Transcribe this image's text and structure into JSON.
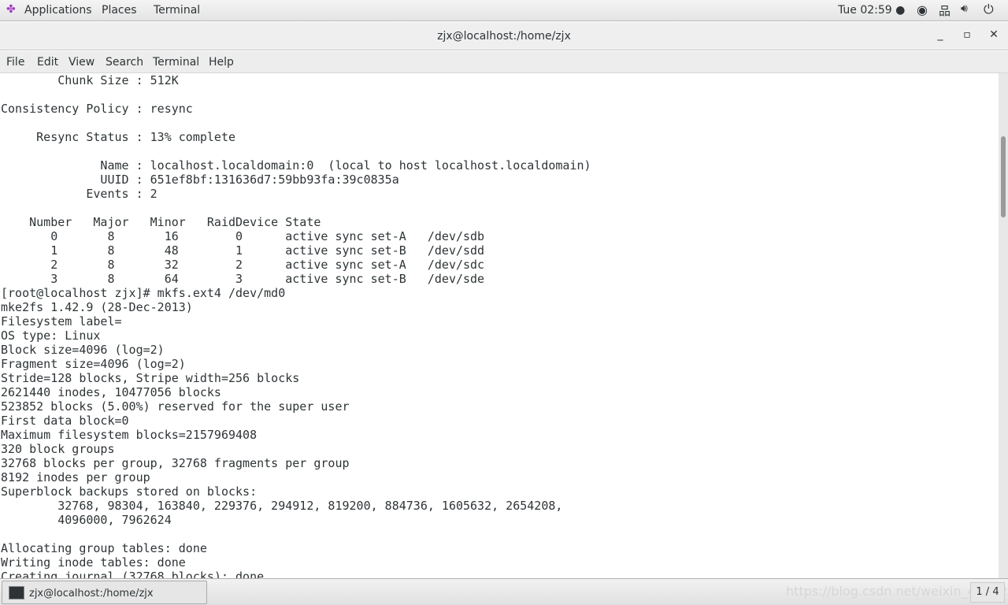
{
  "topbar": {
    "applications": "Applications",
    "places": "Places",
    "terminal": "Terminal",
    "clock": "Tue 02:59 ●",
    "icons": [
      "accessibility-icon",
      "network-icon",
      "volume-icon",
      "power-icon"
    ]
  },
  "window": {
    "title": "zjx@localhost:/home/zjx",
    "minimize": "_",
    "maximize": "▫",
    "close": "✕"
  },
  "menu": [
    "File",
    "Edit",
    "View",
    "Search",
    "Terminal",
    "Help"
  ],
  "terminal": {
    "output": "        Chunk Size : 512K\n\nConsistency Policy : resync\n\n     Resync Status : 13% complete\n\n              Name : localhost.localdomain:0  (local to host localhost.localdomain)\n              UUID : 651ef8bf:131636d7:59bb93fa:39c0835a\n            Events : 2\n\n    Number   Major   Minor   RaidDevice State\n       0       8       16        0      active sync set-A   /dev/sdb\n       1       8       48        1      active sync set-B   /dev/sdd\n       2       8       32        2      active sync set-A   /dev/sdc\n       3       8       64        3      active sync set-B   /dev/sde\n[root@localhost zjx]# mkfs.ext4 /dev/md0\nmke2fs 1.42.9 (28-Dec-2013)\nFilesystem label=\nOS type: Linux\nBlock size=4096 (log=2)\nFragment size=4096 (log=2)\nStride=128 blocks, Stripe width=256 blocks\n2621440 inodes, 10477056 blocks\n523852 blocks (5.00%) reserved for the super user\nFirst data block=0\nMaximum filesystem blocks=2157969408\n320 block groups\n32768 blocks per group, 32768 fragments per group\n8192 inodes per group\nSuperblock backups stored on blocks:\n        32768, 98304, 163840, 229376, 294912, 819200, 884736, 1605632, 2654208,\n        4096000, 7962624\n\nAllocating group tables: done\nWriting inode tables: done\nCreating journal (32768 blocks): done"
  },
  "taskbar": {
    "task_label": "zjx@localhost:/home/zjx",
    "watermark": "https://blog.csdn.net/weixin_44122",
    "pager": "1 / 4"
  }
}
